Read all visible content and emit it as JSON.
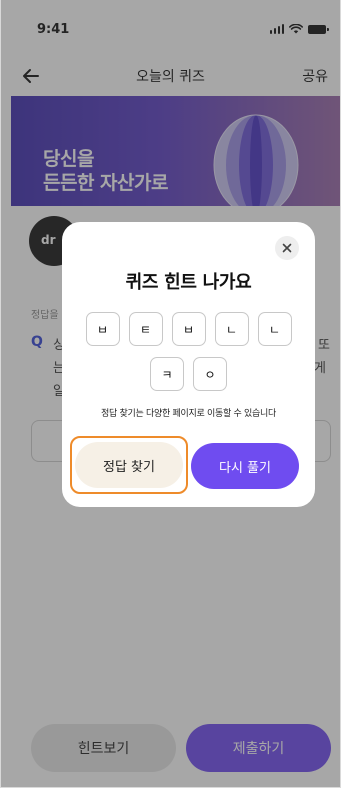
{
  "status_bar": {
    "time": "9:41"
  },
  "nav": {
    "title": "오늘의 퀴즈",
    "share_label": "공유"
  },
  "banner": {
    "line1": "당신을",
    "line2": "든든한 자산가로"
  },
  "card": {
    "avatar_text": "dr",
    "answer_hint_label": "정답을",
    "question_mark": "Q",
    "question_fragments": [
      "싱",
      "는",
      "일",
      "또",
      "게"
    ]
  },
  "bottom": {
    "hint_label": "힌트보기",
    "submit_label": "제출하기"
  },
  "modal": {
    "title": "퀴즈 힌트 나가요",
    "tiles": [
      "ㅂ",
      "ㅌ",
      "ㅂ",
      "ㄴ",
      "ㄴ",
      "ㅋ",
      "ㅇ"
    ],
    "note": "정답 찾기는 다양한 페이지로 이동할 수 있습니다",
    "find_answer_label": "정답 찾기",
    "retry_label": "다시 풀기"
  },
  "colors": {
    "accent": "#6f4cf0",
    "highlight": "#ee8b2a",
    "question_blue": "#3547d8"
  },
  "icons": {
    "back": "back-arrow-icon",
    "close": "close-icon",
    "signal": "signal-icon",
    "wifi": "wifi-icon",
    "battery": "battery-icon"
  }
}
